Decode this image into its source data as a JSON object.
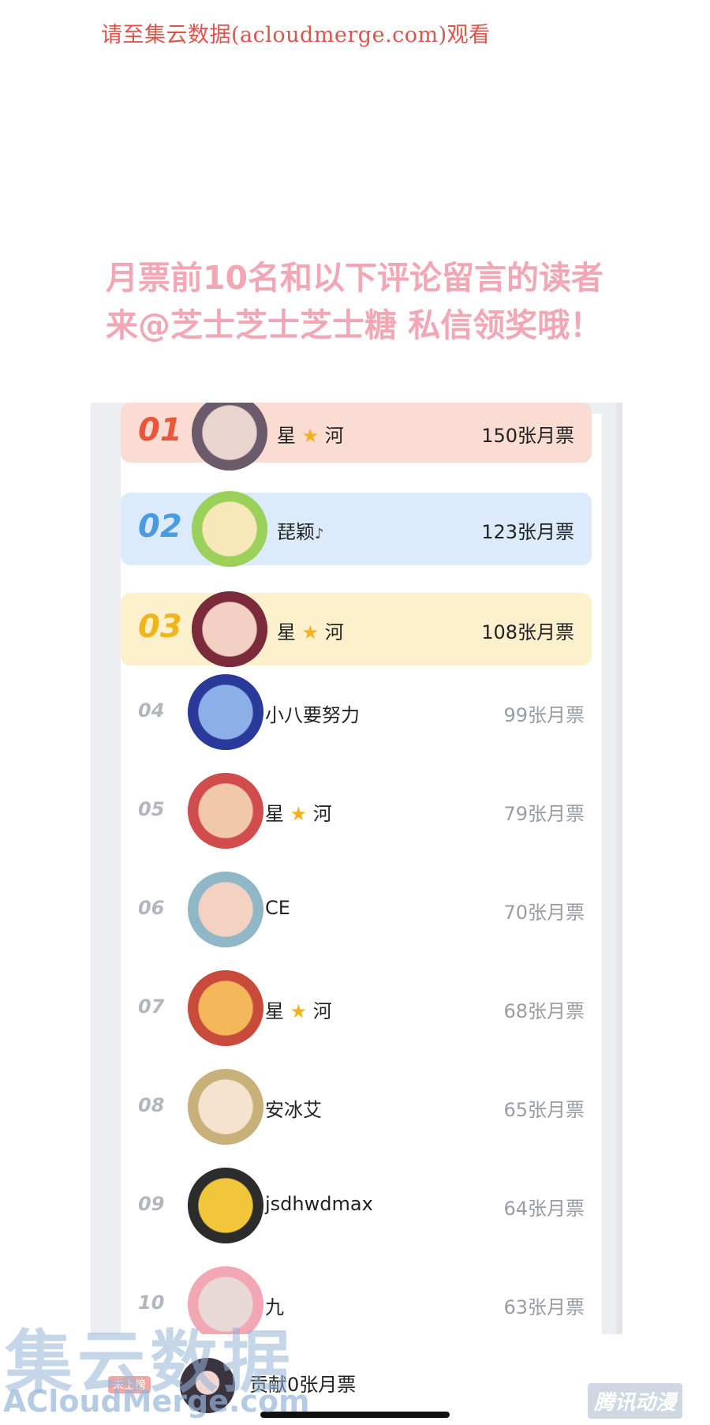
{
  "watermark_top": "请至集云数据(acloudmerge.com)观看",
  "headline": {
    "line1": "月票前10名和以下评论留言的读者",
    "line2": "来@芝士芝士芝士糖 私信领奖哦！"
  },
  "ranking": [
    {
      "rank": "01",
      "name_before": "星",
      "has_star": true,
      "name_after": "河",
      "votes": "150张月票",
      "color": "#e8573a"
    },
    {
      "rank": "02",
      "name_before": "琵颖",
      "has_star": false,
      "name_after": "",
      "votes": "123张月票",
      "color": "#4a9be0"
    },
    {
      "rank": "03",
      "name_before": "星",
      "has_star": true,
      "name_after": "河",
      "votes": "108张月票",
      "color": "#efb51d"
    },
    {
      "rank": "04",
      "name_before": "小八要努力",
      "has_star": false,
      "name_after": "",
      "votes": "99张月票"
    },
    {
      "rank": "05",
      "name_before": "星",
      "has_star": true,
      "name_after": "河",
      "votes": "79张月票"
    },
    {
      "rank": "06",
      "name_before": "CE",
      "has_star": false,
      "name_after": "",
      "votes": "70张月票"
    },
    {
      "rank": "07",
      "name_before": "星",
      "has_star": true,
      "name_after": "河",
      "votes": "68张月票"
    },
    {
      "rank": "08",
      "name_before": "安冰艾",
      "has_star": false,
      "name_after": "",
      "votes": "65张月票"
    },
    {
      "rank": "09",
      "name_before": "jsdhwdmax",
      "has_star": false,
      "name_after": "",
      "votes": "64张月票"
    },
    {
      "rank": "10",
      "name_before": "九",
      "has_star": false,
      "name_after": "",
      "votes": "63张月票"
    }
  ],
  "footer": {
    "tag": "未上榜",
    "text": "贡献0张月票"
  },
  "watermark_logo_cn": "集云数据",
  "watermark_logo_en": "ACloudMerge.com",
  "watermark_brand": "腾讯动漫"
}
